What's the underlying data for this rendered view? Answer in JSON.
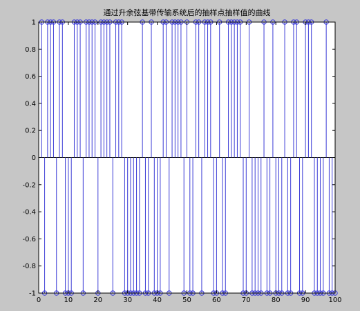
{
  "chart_data": {
    "type": "stem",
    "title": "通过升余弦基带传输系统后的抽样点抽样值的曲线",
    "xlabel": "",
    "ylabel": "",
    "xlim": [
      0,
      100
    ],
    "ylim": [
      -1,
      1
    ],
    "xticks": [
      0,
      10,
      20,
      30,
      40,
      50,
      60,
      70,
      80,
      90,
      100
    ],
    "xtick_labels": [
      "0",
      "10",
      "20",
      "30",
      "40",
      "50",
      "60",
      "70",
      "80",
      "90",
      "100"
    ],
    "yticks": [
      1,
      0.8,
      0.6,
      0.4,
      0.2,
      0,
      -0.2,
      -0.4,
      -0.6,
      -0.8,
      -1
    ],
    "ytick_labels": [
      "1",
      "0.8",
      "0.6",
      "0.4",
      "0.2",
      "0",
      "-0.2",
      "-0.4",
      "-0.6",
      "-0.8",
      "-1"
    ],
    "grid": false,
    "colors": {
      "stem": "#3b3bd6",
      "axes_bg": "#ffffff",
      "figure_bg": "#c6c6c6"
    },
    "x": [
      1,
      2,
      3,
      4,
      5,
      6,
      7,
      8,
      9,
      10,
      11,
      12,
      13,
      14,
      15,
      16,
      17,
      18,
      19,
      20,
      21,
      22,
      23,
      24,
      25,
      26,
      27,
      28,
      29,
      30,
      31,
      32,
      33,
      34,
      35,
      36,
      37,
      38,
      39,
      40,
      41,
      42,
      43,
      44,
      45,
      46,
      47,
      48,
      49,
      50,
      51,
      52,
      53,
      54,
      55,
      56,
      57,
      58,
      59,
      60,
      61,
      62,
      63,
      64,
      65,
      66,
      67,
      68,
      69,
      70,
      71,
      72,
      73,
      74,
      75,
      76,
      77,
      78,
      79,
      80,
      81,
      82,
      83,
      84,
      85,
      86,
      87,
      88,
      89,
      90,
      91,
      92,
      93,
      94,
      95,
      96,
      97,
      98,
      99,
      100
    ],
    "values": [
      1,
      -1,
      1,
      1,
      1,
      -1,
      1,
      1,
      -1,
      -1,
      -1,
      1,
      1,
      1,
      -1,
      1,
      1,
      1,
      1,
      -1,
      1,
      1,
      1,
      1,
      -1,
      1,
      1,
      1,
      -1,
      -1,
      -1,
      -1,
      -1,
      -1,
      1,
      -1,
      -1,
      1,
      -1,
      -1,
      -1,
      1,
      1,
      -1,
      1,
      1,
      1,
      1,
      -1,
      1,
      -1,
      -1,
      1,
      1,
      -1,
      1,
      1,
      1,
      -1,
      -1,
      1,
      -1,
      -1,
      1,
      1,
      1,
      1,
      1,
      -1,
      -1,
      1,
      -1,
      -1,
      -1,
      -1,
      1,
      -1,
      -1,
      1,
      -1,
      -1,
      -1,
      1,
      -1,
      -1,
      1,
      1,
      -1,
      -1,
      1,
      1,
      1,
      -1,
      -1,
      -1,
      -1,
      1,
      -1,
      -1,
      -1
    ]
  }
}
